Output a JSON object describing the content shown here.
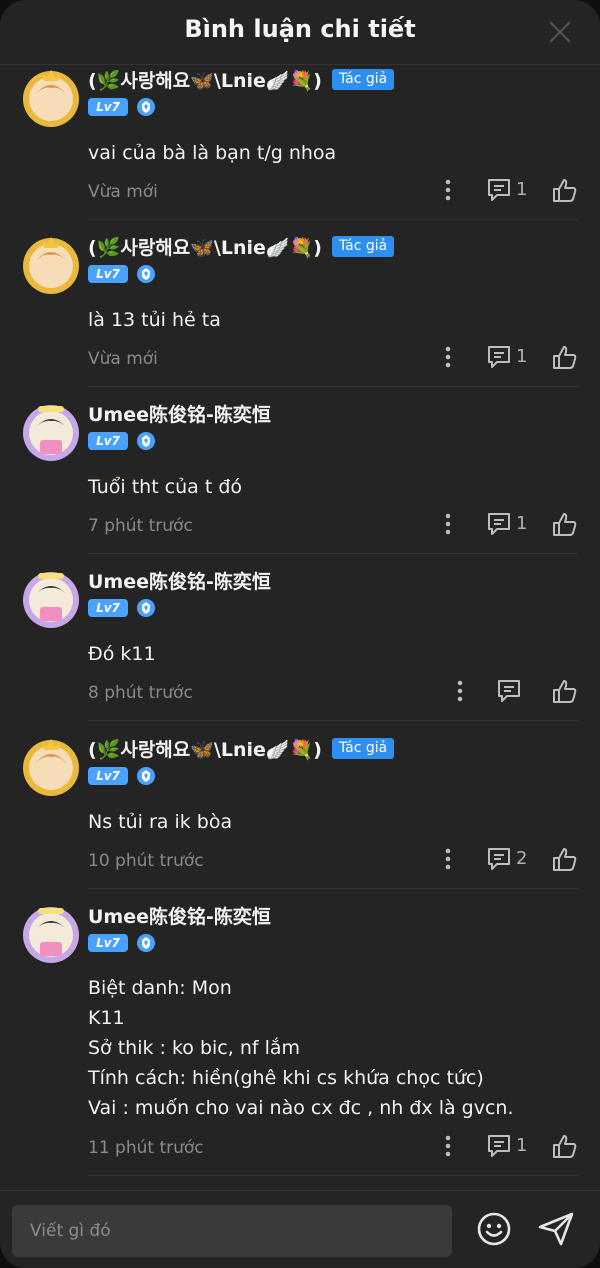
{
  "header": {
    "title": "Bình luận chi tiết"
  },
  "author_badge": "Tác giả",
  "comments": [
    {
      "user": "(🌿사랑해요🦋\\Lnie🪽💐)",
      "author": true,
      "level": "Lv7",
      "text": "vai của bà là bạn t/g nhoa",
      "time": "Vừa mới",
      "replies": "1"
    },
    {
      "user": "(🌿사랑해요🦋\\Lnie🪽💐)",
      "author": true,
      "level": "Lv7",
      "text": "là 13 tủi hẻ ta",
      "time": "Vừa mới",
      "replies": "1"
    },
    {
      "user": "Umee陈俊铭-陈奕恒",
      "author": false,
      "level": "Lv7",
      "text": "Tuổi tht của t đó",
      "time": "7 phút trước",
      "replies": "1"
    },
    {
      "user": "Umee陈俊铭-陈奕恒",
      "author": false,
      "level": "Lv7",
      "text": "Đó k11",
      "time": "8 phút trước",
      "replies": ""
    },
    {
      "user": "(🌿사랑해요🦋\\Lnie🪽💐)",
      "author": true,
      "level": "Lv7",
      "text": "Ns tủi ra ik bòa",
      "time": "10 phút trước",
      "replies": "2"
    },
    {
      "user": "Umee陈俊铭-陈奕恒",
      "author": false,
      "level": "Lv7",
      "text": "Biệt danh: Mon\nK11\nSở thik : ko bic, nf lắm\nTính cách: hiền(ghê khi cs khứa chọc tức)\nVai : muốn cho vai nào cx đc , nh đx là gvcn.",
      "time": "11 phút trước",
      "replies": "1"
    }
  ],
  "footer": {
    "placeholder": "Viết gì đó"
  }
}
